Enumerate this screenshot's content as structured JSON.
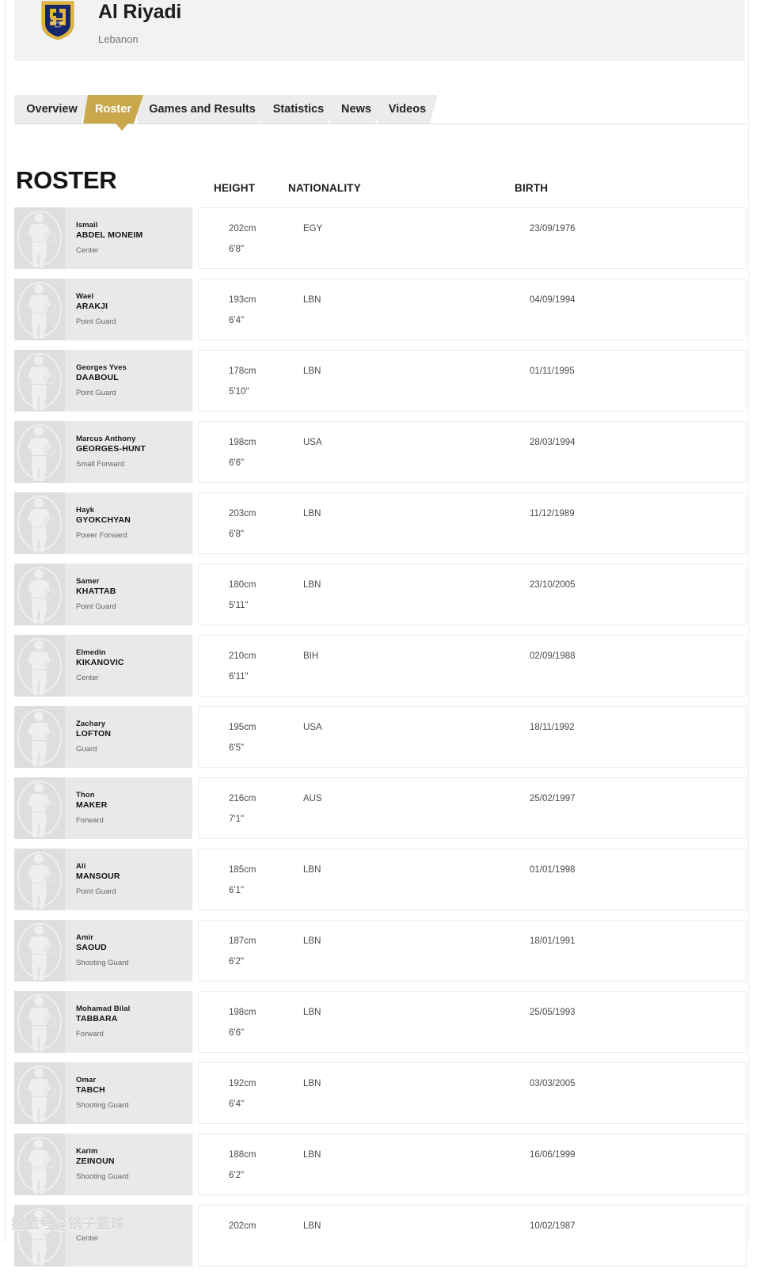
{
  "club": {
    "name": "Al Riyadi",
    "country": "Lebanon",
    "crest_icon": "club-crest-icon",
    "crest_colors": {
      "shield": "#16276b",
      "border": "#e3b63a"
    }
  },
  "tabs": [
    {
      "label": "Overview",
      "active": false
    },
    {
      "label": "Roster",
      "active": true
    },
    {
      "label": "Games and Results",
      "active": false
    },
    {
      "label": "Statistics",
      "active": false
    },
    {
      "label": "News",
      "active": false
    },
    {
      "label": "Videos",
      "active": false
    }
  ],
  "theme": {
    "accent_gold": "#c9a84c",
    "tab_inactive_bg": "#ececec",
    "banner_bg": "#f2f2f2",
    "thumb_bg": "#dedede",
    "player_panel_bg": "#e9e9e9"
  },
  "roster": {
    "title": "ROSTER",
    "columns": {
      "height": "HEIGHT",
      "nationality": "NATIONALITY",
      "birth": "BIRTH"
    },
    "players": [
      {
        "first": "Ismail",
        "last": "ABDEL MONEIM",
        "position": "Center",
        "height_cm": "202cm",
        "height_ft": "6'8\"",
        "nationality": "EGY",
        "birth": "23/09/1976"
      },
      {
        "first": "Wael",
        "last": "ARAKJI",
        "position": "Point Guard",
        "height_cm": "193cm",
        "height_ft": "6'4\"",
        "nationality": "LBN",
        "birth": "04/09/1994"
      },
      {
        "first": "Georges Yves",
        "last": "DAABOUL",
        "position": "Point Guard",
        "height_cm": "178cm",
        "height_ft": "5'10\"",
        "nationality": "LBN",
        "birth": "01/11/1995"
      },
      {
        "first": "Marcus Anthony",
        "last": "GEORGES-HUNT",
        "position": "Small Forward",
        "height_cm": "198cm",
        "height_ft": "6'6\"",
        "nationality": "USA",
        "birth": "28/03/1994"
      },
      {
        "first": "Hayk",
        "last": "GYOKCHYAN",
        "position": "Power Forward",
        "height_cm": "203cm",
        "height_ft": "6'8\"",
        "nationality": "LBN",
        "birth": "11/12/1989"
      },
      {
        "first": "Samer",
        "last": "KHATTAB",
        "position": "Point Guard",
        "height_cm": "180cm",
        "height_ft": "5'11\"",
        "nationality": "LBN",
        "birth": "23/10/2005"
      },
      {
        "first": "Elmedin",
        "last": "KIKANOVIC",
        "position": "Center",
        "height_cm": "210cm",
        "height_ft": "6'11\"",
        "nationality": "BIH",
        "birth": "02/09/1988"
      },
      {
        "first": "Zachary",
        "last": "LOFTON",
        "position": "Guard",
        "height_cm": "195cm",
        "height_ft": "6'5\"",
        "nationality": "USA",
        "birth": "18/11/1992"
      },
      {
        "first": "Thon",
        "last": "MAKER",
        "position": "Forward",
        "height_cm": "216cm",
        "height_ft": "7'1\"",
        "nationality": "AUS",
        "birth": "25/02/1997"
      },
      {
        "first": "Ali",
        "last": "MANSOUR",
        "position": "Point Guard",
        "height_cm": "185cm",
        "height_ft": "6'1\"",
        "nationality": "LBN",
        "birth": "01/01/1998"
      },
      {
        "first": "Amir",
        "last": "SAOUD",
        "position": "Shooting Guard",
        "height_cm": "187cm",
        "height_ft": "6'2\"",
        "nationality": "LBN",
        "birth": "18/01/1991"
      },
      {
        "first": "Mohamad Bilal",
        "last": "TABBARA",
        "position": "Forward",
        "height_cm": "198cm",
        "height_ft": "6'6\"",
        "nationality": "LBN",
        "birth": "25/05/1993"
      },
      {
        "first": "Omar",
        "last": "TABCH",
        "position": "Shooting Guard",
        "height_cm": "192cm",
        "height_ft": "6'4\"",
        "nationality": "LBN",
        "birth": "03/03/2005"
      },
      {
        "first": "Karim",
        "last": "ZEINOUN",
        "position": "Shooting Guard",
        "height_cm": "188cm",
        "height_ft": "6'2\"",
        "nationality": "LBN",
        "birth": "16/06/1999"
      },
      {
        "first": "",
        "last": "",
        "position": "Center",
        "height_cm": "202cm",
        "height_ft": "",
        "nationality": "LBN",
        "birth": "10/02/1987"
      }
    ]
  },
  "watermark": {
    "text": "搜狐号@锅子篮球"
  }
}
